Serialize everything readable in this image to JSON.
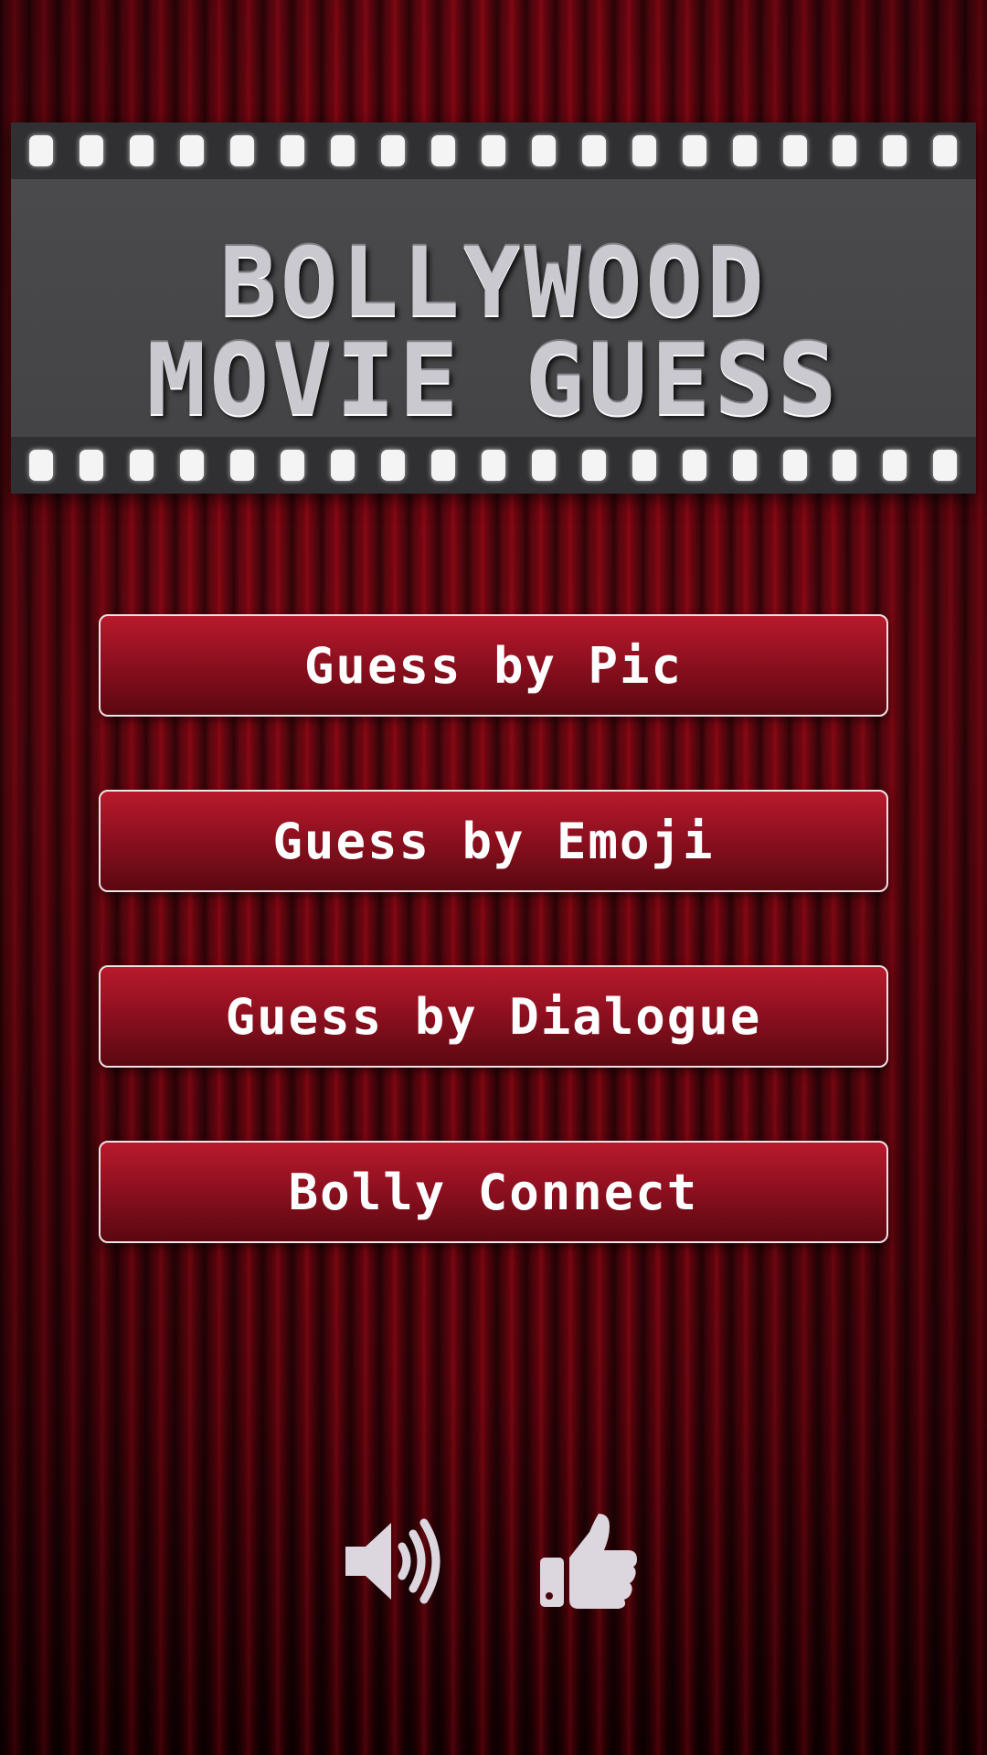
{
  "banner": {
    "title_line1": "BOLLYWOOD",
    "title_line2": "MOVIE GUESS"
  },
  "menu": {
    "buttons": [
      {
        "label": "Guess by Pic"
      },
      {
        "label": "Guess by Emoji"
      },
      {
        "label": "Guess by Dialogue"
      },
      {
        "label": "Bolly Connect"
      }
    ]
  },
  "footer": {
    "icons": [
      "speaker-volume-icon",
      "thumbs-up-icon"
    ],
    "icon_color": "#dcd6de"
  },
  "colors": {
    "background": "#5e0710",
    "button_top": "#b81a2c",
    "button_bottom": "#5a0810",
    "button_border": "#f1e3e6",
    "banner": "#3e3e40"
  }
}
